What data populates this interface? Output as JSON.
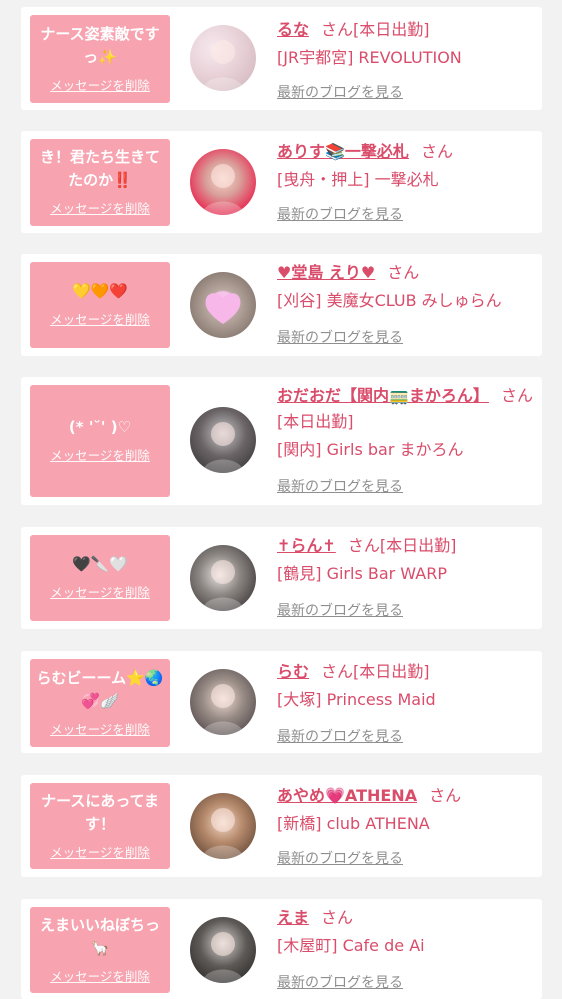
{
  "delete_label": "メッセージを削除",
  "blog_label": "最新のブログを見る",
  "san_label": "さん",
  "colors": {
    "accent": "#d94c6a",
    "bubble": "#f7a3b0",
    "muted": "#8f8f8f",
    "background": "#f3f2f2"
  },
  "entries": [
    {
      "message": "ナース姿素敵ですっ✨",
      "name": "るな",
      "status": "[本日出勤]",
      "shop": "[JR宇都宮] REVOLUTION",
      "avatar_icon": "user-photo-icon"
    },
    {
      "message": "き！君たち生きてたのか‼️",
      "name": "ありす📚一撃必札",
      "status": "",
      "shop": "[曳舟・押上] 一撃必札",
      "avatar_icon": "user-photo-icon"
    },
    {
      "message": "💛🧡❤️",
      "name": "♥堂島 えり♥",
      "status": "",
      "shop": "[刈谷] 美魔女CLUB みしゅらん",
      "avatar_icon": "heart-mask-photo-icon"
    },
    {
      "message": "(* '˘' )♡",
      "name": "おだおだ【関内🚃まかろん】",
      "status": "[本日出勤]",
      "shop": "[関内] Girls bar まかろん",
      "avatar_icon": "user-photo-icon"
    },
    {
      "message": "🖤🔪🤍",
      "name": "✝らん✝",
      "status": "[本日出勤]",
      "shop": "[鶴見] Girls Bar WARP",
      "avatar_icon": "user-photo-icon"
    },
    {
      "message": "らむビーーム⭐🌏💞🪽",
      "name": "らむ",
      "status": "[本日出勤]",
      "shop": "[大塚] Princess Maid",
      "avatar_icon": "user-photo-icon"
    },
    {
      "message": "ナースにあってます！",
      "name": "あやめ💗ATHENA",
      "status": "",
      "shop": "[新橋] club ATHENA",
      "avatar_icon": "user-photo-icon"
    },
    {
      "message": "えまいいねぼちっ🦙",
      "name": "えま",
      "status": "",
      "shop": "[木屋町] Cafe de Ai",
      "avatar_icon": "user-photo-icon"
    }
  ]
}
